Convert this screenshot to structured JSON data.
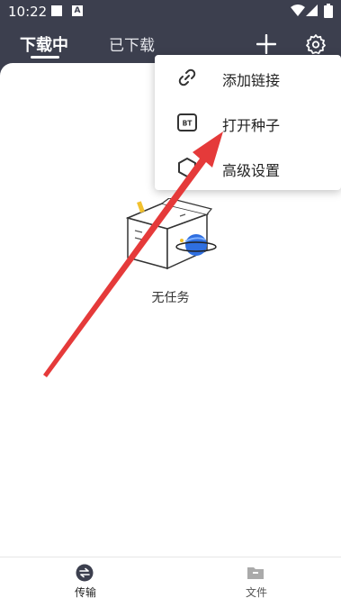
{
  "status_bar": {
    "time": "10:22",
    "a_badge": "A",
    "icons": [
      "notification-square-icon",
      "a-badge-icon",
      "wifi-icon",
      "signal-icon",
      "battery-icon"
    ]
  },
  "tabs": [
    {
      "label": "下载中",
      "active": true
    },
    {
      "label": "已下载",
      "active": false
    }
  ],
  "toolbar_icons": [
    "plus-icon",
    "gear-icon"
  ],
  "menu": {
    "items": [
      {
        "label": "添加链接",
        "icon": "link-icon"
      },
      {
        "label": "打开种子",
        "icon": "bt-torrent-icon",
        "icon_text": "BT"
      },
      {
        "label": "高级设置",
        "icon": "hexagon-settings-icon"
      }
    ]
  },
  "empty_state": {
    "text": "无任务"
  },
  "bottom_nav": [
    {
      "label": "传输",
      "icon": "transfer-icon",
      "active": true
    },
    {
      "label": "文件",
      "icon": "folder-icon",
      "active": false
    }
  ],
  "colors": {
    "header_bg": "#3c3f4e",
    "arrow": "#e53a3a",
    "planet": "#2f6fe0"
  }
}
